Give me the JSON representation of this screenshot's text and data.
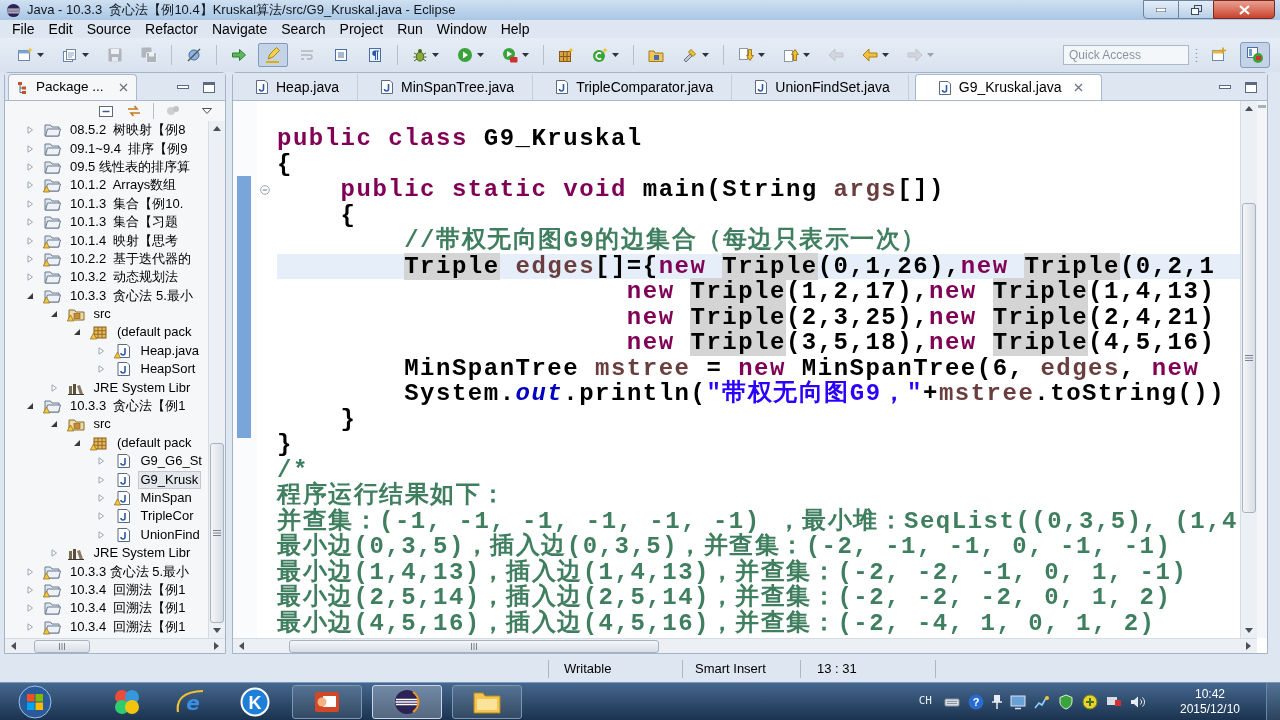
{
  "window": {
    "title": "Java - 10.3.3  贪心法【例10.4】Kruskal算法/src/G9_Kruskal.java - Eclipse"
  },
  "menu": [
    "File",
    "Edit",
    "Source",
    "Refactor",
    "Navigate",
    "Search",
    "Project",
    "Run",
    "Window",
    "Help"
  ],
  "toolbar": {
    "groups": [
      [
        {
          "kind": "new",
          "dropdown": true,
          "disabled": false,
          "on": false
        },
        {
          "kind": "newproject",
          "dropdown": true,
          "disabled": false,
          "on": false
        },
        {
          "kind": "save",
          "dropdown": false,
          "disabled": true,
          "on": false
        },
        {
          "kind": "saveall",
          "dropdown": false,
          "disabled": true,
          "on": false
        }
      ],
      [
        {
          "kind": "skipbreakpoints",
          "dropdown": false,
          "disabled": false,
          "on": false
        }
      ],
      [
        {
          "kind": "opentask",
          "dropdown": false,
          "disabled": false,
          "on": false
        },
        {
          "kind": "occurrences",
          "dropdown": false,
          "disabled": false,
          "on": true
        },
        {
          "kind": "wordwrap",
          "dropdown": false,
          "disabled": true,
          "on": false
        },
        {
          "kind": "blockselect",
          "dropdown": false,
          "disabled": false,
          "on": false
        },
        {
          "kind": "whitespace",
          "dropdown": false,
          "disabled": false,
          "on": false
        }
      ],
      [
        {
          "kind": "debug",
          "dropdown": true,
          "disabled": false,
          "on": false
        },
        {
          "kind": "run",
          "dropdown": true,
          "disabled": false,
          "on": false
        },
        {
          "kind": "external",
          "dropdown": true,
          "disabled": false,
          "on": false
        }
      ],
      [
        {
          "kind": "newpackage",
          "dropdown": false,
          "disabled": false,
          "on": false
        },
        {
          "kind": "newclass",
          "dropdown": true,
          "disabled": false,
          "on": false
        }
      ],
      [
        {
          "kind": "opentype",
          "dropdown": false,
          "disabled": false,
          "on": false
        },
        {
          "kind": "search",
          "dropdown": true,
          "disabled": false,
          "on": false
        }
      ],
      [
        {
          "kind": "nextannotation",
          "dropdown": true,
          "disabled": false,
          "on": false
        },
        {
          "kind": "prevannotation",
          "dropdown": true,
          "disabled": false,
          "on": false
        },
        {
          "kind": "lastedit",
          "dropdown": false,
          "disabled": true,
          "on": false
        },
        {
          "kind": "back",
          "dropdown": true,
          "disabled": false,
          "on": false
        },
        {
          "kind": "forward",
          "dropdown": true,
          "disabled": true,
          "on": false
        }
      ]
    ],
    "quick_access": {
      "placeholder": "Quick Access"
    },
    "perspectives": [
      {
        "kind": "open",
        "selected": false
      },
      {
        "kind": "java",
        "selected": true
      }
    ]
  },
  "package_explorer": {
    "title": "Package ...",
    "tree": [
      {
        "label": "08.5.2  树映射【例8",
        "kind": "project",
        "warning": false,
        "expanded": false,
        "selected": false
      },
      {
        "label": "09.1~9.4  排序【例9",
        "kind": "project",
        "warning": false,
        "expanded": false,
        "selected": false
      },
      {
        "label": "09.5 线性表的排序算",
        "kind": "project",
        "warning": false,
        "expanded": false,
        "selected": false
      },
      {
        "label": "10.1.2  Arrays数组",
        "kind": "project",
        "warning": true,
        "expanded": false,
        "selected": false
      },
      {
        "label": "10.1.3  集合【例10.",
        "kind": "project",
        "warning": false,
        "expanded": false,
        "selected": false
      },
      {
        "label": "10.1.3  集合【习题",
        "kind": "project",
        "warning": false,
        "expanded": false,
        "selected": false
      },
      {
        "label": "10.1.4  映射【思考",
        "kind": "project",
        "warning": true,
        "expanded": false,
        "selected": false
      },
      {
        "label": "10.2.2  基于迭代器的",
        "kind": "project",
        "warning": true,
        "expanded": false,
        "selected": false
      },
      {
        "label": "10.3.2  动态规划法",
        "kind": "project",
        "warning": false,
        "expanded": false,
        "selected": false
      },
      {
        "label": "10.3.3  贪心法 5.最小",
        "kind": "project",
        "warning": true,
        "expanded": true,
        "selected": false,
        "children": [
          {
            "label": "src",
            "kind": "source",
            "warning": true,
            "expanded": true,
            "selected": false,
            "children": [
              {
                "label": "(default pack",
                "kind": "package",
                "warning": true,
                "expanded": true,
                "selected": false,
                "children": [
                  {
                    "label": "Heap.java",
                    "kind": "file",
                    "warning": true,
                    "expanded": false,
                    "selected": false
                  },
                  {
                    "label": "HeapSort",
                    "kind": "file",
                    "warning": false,
                    "expanded": false,
                    "selected": false
                  }
                ]
              }
            ]
          },
          {
            "label": "JRE System Libr",
            "kind": "library",
            "warning": false,
            "expanded": false,
            "selected": false
          }
        ]
      },
      {
        "label": "10.3.3  贪心法【例1",
        "kind": "project",
        "warning": true,
        "expanded": true,
        "selected": false,
        "children": [
          {
            "label": "src",
            "kind": "source",
            "warning": true,
            "expanded": true,
            "selected": false,
            "children": [
              {
                "label": "(default pack",
                "kind": "package",
                "warning": true,
                "expanded": true,
                "selected": false,
                "children": [
                  {
                    "label": "G9_G6_St",
                    "kind": "file",
                    "warning": false,
                    "expanded": false,
                    "selected": false
                  },
                  {
                    "label": "G9_Krusk",
                    "kind": "file",
                    "warning": false,
                    "expanded": false,
                    "selected": true
                  },
                  {
                    "label": "MinSpan",
                    "kind": "file",
                    "warning": true,
                    "expanded": false,
                    "selected": false
                  },
                  {
                    "label": "TripleCor",
                    "kind": "file",
                    "warning": false,
                    "expanded": false,
                    "selected": false
                  },
                  {
                    "label": "UnionFind",
                    "kind": "file",
                    "warning": false,
                    "expanded": false,
                    "selected": false
                  }
                ]
              }
            ]
          },
          {
            "label": "JRE System Libr",
            "kind": "library",
            "warning": false,
            "expanded": false,
            "selected": false
          }
        ]
      },
      {
        "label": "10.3.3 贪心法 5.最小",
        "kind": "project",
        "warning": true,
        "expanded": false,
        "selected": false
      },
      {
        "label": "10.3.4  回溯法【例1",
        "kind": "project",
        "warning": true,
        "expanded": false,
        "selected": false
      },
      {
        "label": "10.3.4  回溯法【例1",
        "kind": "project",
        "warning": false,
        "expanded": false,
        "selected": false
      },
      {
        "label": "10.3.4  回溯法【例1",
        "kind": "project",
        "warning": true,
        "expanded": false,
        "selected": false
      }
    ]
  },
  "editor": {
    "tabs": [
      {
        "label": "Heap.java",
        "selected": false
      },
      {
        "label": "MinSpanTree.java",
        "selected": false
      },
      {
        "label": "TripleComparator.java",
        "selected": false
      },
      {
        "label": "UnionFindSet.java",
        "selected": false
      },
      {
        "label": "G9_Kruskal.java",
        "selected": true
      }
    ],
    "lines": [
      {
        "current": false,
        "tokens": [
          {
            "kind": "keyword",
            "text": "public class"
          },
          {
            "kind": "plain",
            "text": " G9_Kruskal"
          }
        ]
      },
      {
        "current": false,
        "tokens": [
          {
            "kind": "plain",
            "text": "{"
          }
        ]
      },
      {
        "current": false,
        "tokens": [
          {
            "kind": "keyword",
            "text": "    public static void"
          },
          {
            "kind": "plain",
            "text": " main(String "
          },
          {
            "kind": "variable",
            "text": "args"
          },
          {
            "kind": "plain",
            "text": "[])"
          }
        ]
      },
      {
        "current": false,
        "tokens": [
          {
            "kind": "plain",
            "text": "    {"
          }
        ]
      },
      {
        "current": false,
        "tokens": [
          {
            "kind": "comment",
            "text": "        //带权无向图G9的边集合（每边只表示一次）"
          }
        ]
      },
      {
        "current": true,
        "tokens": [
          {
            "kind": "occurrence",
            "text": "        Triple"
          },
          {
            "kind": "variable",
            "text": " edges"
          },
          {
            "kind": "plain",
            "text": "[]={"
          },
          {
            "kind": "keyword",
            "text": "new"
          },
          {
            "kind": "occurrence",
            "text": " Triple"
          },
          {
            "kind": "plain",
            "text": "(0,1,26),"
          },
          {
            "kind": "keyword",
            "text": "new"
          },
          {
            "kind": "occurrence",
            "text": " Triple"
          },
          {
            "kind": "plain",
            "text": "(0,2,1"
          }
        ]
      },
      {
        "current": false,
        "tokens": [
          {
            "kind": "keyword",
            "text": "                      new"
          },
          {
            "kind": "occurrence",
            "text": " Triple"
          },
          {
            "kind": "plain",
            "text": "(1,2,17),"
          },
          {
            "kind": "keyword",
            "text": "new"
          },
          {
            "kind": "occurrence",
            "text": " Triple"
          },
          {
            "kind": "plain",
            "text": "(1,4,13)"
          }
        ]
      },
      {
        "current": false,
        "tokens": [
          {
            "kind": "keyword",
            "text": "                      new"
          },
          {
            "kind": "occurrence",
            "text": " Triple"
          },
          {
            "kind": "plain",
            "text": "(2,3,25),"
          },
          {
            "kind": "keyword",
            "text": "new"
          },
          {
            "kind": "occurrence",
            "text": " Triple"
          },
          {
            "kind": "plain",
            "text": "(2,4,21)"
          }
        ]
      },
      {
        "current": false,
        "tokens": [
          {
            "kind": "keyword",
            "text": "                      new"
          },
          {
            "kind": "occurrence",
            "text": " Triple"
          },
          {
            "kind": "plain",
            "text": "(3,5,18),"
          },
          {
            "kind": "keyword",
            "text": "new"
          },
          {
            "kind": "occurrence",
            "text": " Triple"
          },
          {
            "kind": "plain",
            "text": "(4,5,16)"
          }
        ]
      },
      {
        "current": false,
        "tokens": [
          {
            "kind": "plain",
            "text": "        MinSpanTree"
          },
          {
            "kind": "variable",
            "text": " mstree"
          },
          {
            "kind": "plain",
            "text": " ="
          },
          {
            "kind": "keyword",
            "text": " new"
          },
          {
            "kind": "plain",
            "text": " MinSpanTree(6,"
          },
          {
            "kind": "variable",
            "text": " edges"
          },
          {
            "kind": "plain",
            "text": ","
          },
          {
            "kind": "keyword",
            "text": " new"
          }
        ]
      },
      {
        "current": false,
        "tokens": [
          {
            "kind": "plain",
            "text": "        System."
          },
          {
            "kind": "field",
            "text": "out"
          },
          {
            "kind": "plain",
            "text": ".println("
          },
          {
            "kind": "string",
            "text": "\"带权无向图G9，\""
          },
          {
            "kind": "plain",
            "text": "+"
          },
          {
            "kind": "variable",
            "text": "mstree"
          },
          {
            "kind": "plain",
            "text": ".toString())"
          }
        ]
      },
      {
        "current": false,
        "tokens": [
          {
            "kind": "plain",
            "text": "    }"
          }
        ]
      },
      {
        "current": false,
        "tokens": [
          {
            "kind": "plain",
            "text": "}"
          }
        ]
      },
      {
        "current": false,
        "tokens": [
          {
            "kind": "comment",
            "text": "/*"
          }
        ]
      },
      {
        "current": false,
        "tokens": [
          {
            "kind": "comment",
            "text": "程序运行结果如下："
          }
        ]
      },
      {
        "current": false,
        "tokens": [
          {
            "kind": "comment",
            "text": "并查集：(-1, -1, -1, -1, -1, -1) ，最小堆：SeqList((0,3,5), (1,4"
          }
        ]
      },
      {
        "current": false,
        "tokens": [
          {
            "kind": "comment",
            "text": "最小边(0,3,5)，插入边(0,3,5)，并查集：(-2, -1, -1, 0, -1, -1)"
          }
        ]
      },
      {
        "current": false,
        "tokens": [
          {
            "kind": "comment",
            "text": "最小边(1,4,13)，插入边(1,4,13)，并查集：(-2, -2, -1, 0, 1, -1)"
          }
        ]
      },
      {
        "current": false,
        "tokens": [
          {
            "kind": "comment",
            "text": "最小边(2,5,14)，插入边(2,5,14)，并查集：(-2, -2, -2, 0, 1, 2)"
          }
        ]
      },
      {
        "current": false,
        "tokens": [
          {
            "kind": "comment",
            "text": "最小边(4,5,16)，插入边(4,5,16)，并查集：(-2, -4, 1, 0, 1, 2)"
          }
        ]
      }
    ]
  },
  "status_bar": {
    "fields": [
      "Writable",
      "Smart Insert",
      "13 : 31"
    ]
  },
  "taskbar": {
    "apps": [
      {
        "kind": "palette",
        "running": false,
        "active": false
      },
      {
        "kind": "browser",
        "glyph": "e",
        "running": false,
        "active": false
      },
      {
        "kind": "letter",
        "glyph": "K",
        "running": false,
        "active": false
      },
      {
        "kind": "slides",
        "running": true,
        "active": false
      },
      {
        "kind": "eclipse",
        "running": true,
        "active": true
      },
      {
        "kind": "folder",
        "running": true,
        "active": false
      }
    ],
    "tray": {
      "language": "CH",
      "icons": [
        {
          "kind": "keyboard"
        },
        {
          "kind": "help",
          "glyph": "?"
        },
        {
          "kind": "pin"
        },
        {
          "kind": "monitor"
        },
        {
          "kind": "network"
        },
        {
          "kind": "shield"
        },
        {
          "kind": "plus"
        },
        {
          "kind": "flag"
        },
        {
          "kind": "volume"
        }
      ],
      "time": "10:42",
      "date": "2015/12/10"
    }
  }
}
